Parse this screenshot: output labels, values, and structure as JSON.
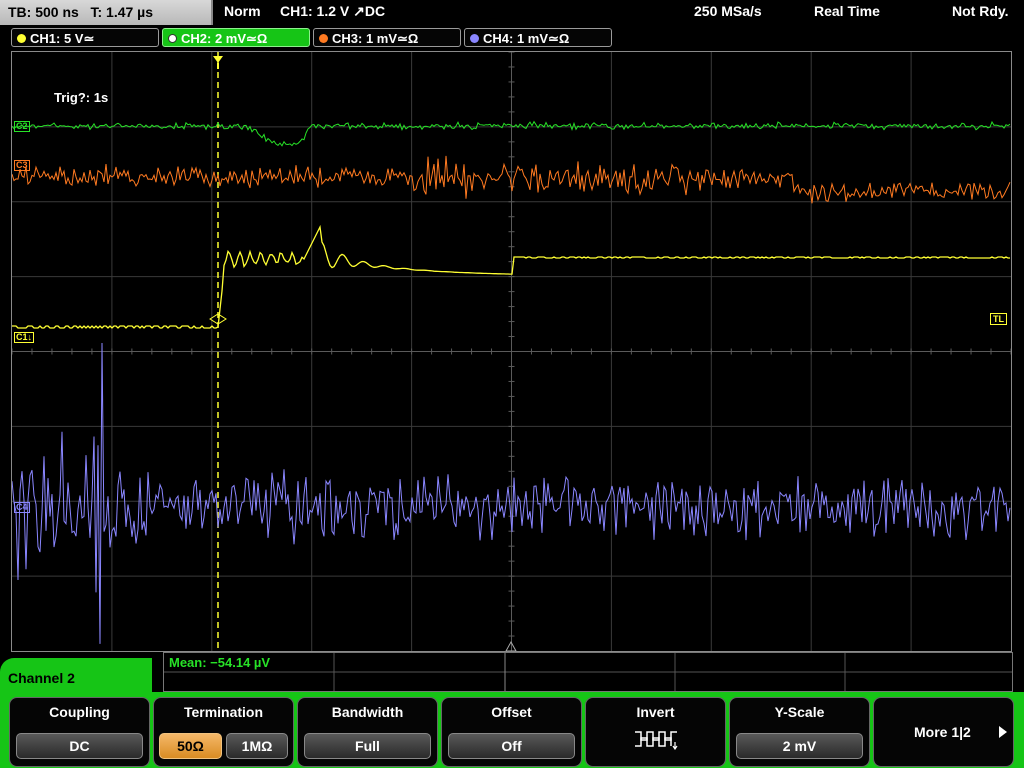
{
  "status": {
    "timebase": "TB: 500 ns",
    "trigger_time": "T: 1.47 µs",
    "mode": "Norm",
    "trigger_info": "CH1: 1.2 V ↗DC",
    "sample_rate": "250 MSa/s",
    "acq_mode": "Real Time",
    "ready_state": "Not Rdy."
  },
  "channels": [
    {
      "label": "CH1: 5 V≃",
      "color": "#ffff33"
    },
    {
      "label": "CH2: 2 mV≃Ω",
      "color": "#27e227"
    },
    {
      "label": "CH3: 1 mV≃Ω",
      "color": "#ff7a21"
    },
    {
      "label": "CH4: 1 mV≃Ω",
      "color": "#8a86ff"
    }
  ],
  "trace_labels": {
    "ch1": "C1↓",
    "ch2": "C2",
    "ch3": "C3",
    "ch4": "C4",
    "trigger_level": "TL"
  },
  "trig_status": "Trig?: 1s",
  "measurement": "Mean: −54.14 µV",
  "menu": {
    "title": "Channel 2",
    "coupling": {
      "label": "Coupling",
      "value": "DC"
    },
    "termination": {
      "label": "Termination",
      "opt1": "50Ω",
      "opt2": "1MΩ"
    },
    "bandwidth": {
      "label": "Bandwidth",
      "value": "Full"
    },
    "offset": {
      "label": "Offset",
      "value": "Off"
    },
    "invert": {
      "label": "Invert"
    },
    "yscale": {
      "label": "Y-Scale",
      "value": "2 mV"
    },
    "more": {
      "label": "More 1|2"
    }
  }
}
